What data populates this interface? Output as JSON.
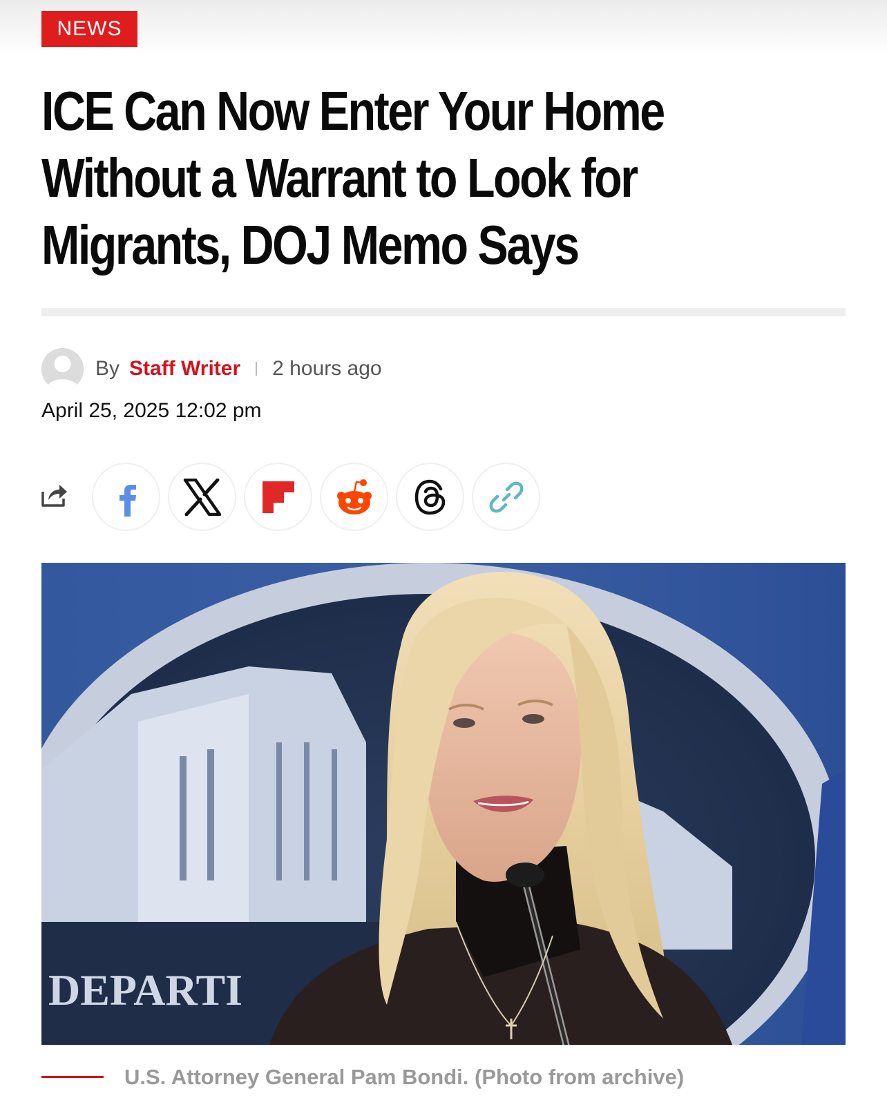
{
  "category_badge": "NEWS",
  "headline": {
    "line1": "ICE Can Now Enter Your Home",
    "line2": "Without a Warrant to Look for",
    "line3": "Migrants, DOJ Memo Says"
  },
  "byline": {
    "prefix": "By",
    "author": "Staff Writer",
    "relative_time": "2 hours ago",
    "date": "April 25, 2025 12:02 pm"
  },
  "share": {
    "icons": [
      "share-icon",
      "facebook-icon",
      "x-icon",
      "flipboard-icon",
      "reddit-icon",
      "threads-icon",
      "link-icon"
    ]
  },
  "hero": {
    "seal_text": "DEPARTI"
  },
  "caption": "U.S. Attorney General Pam Bondi. (Photo from archive)",
  "colors": {
    "accent": "#e01d1d",
    "author": "#d4121b",
    "facebook": "#5b8ee6",
    "flipboard": "#e12828",
    "reddit": "#ff4500",
    "link": "#5fb6c4"
  }
}
